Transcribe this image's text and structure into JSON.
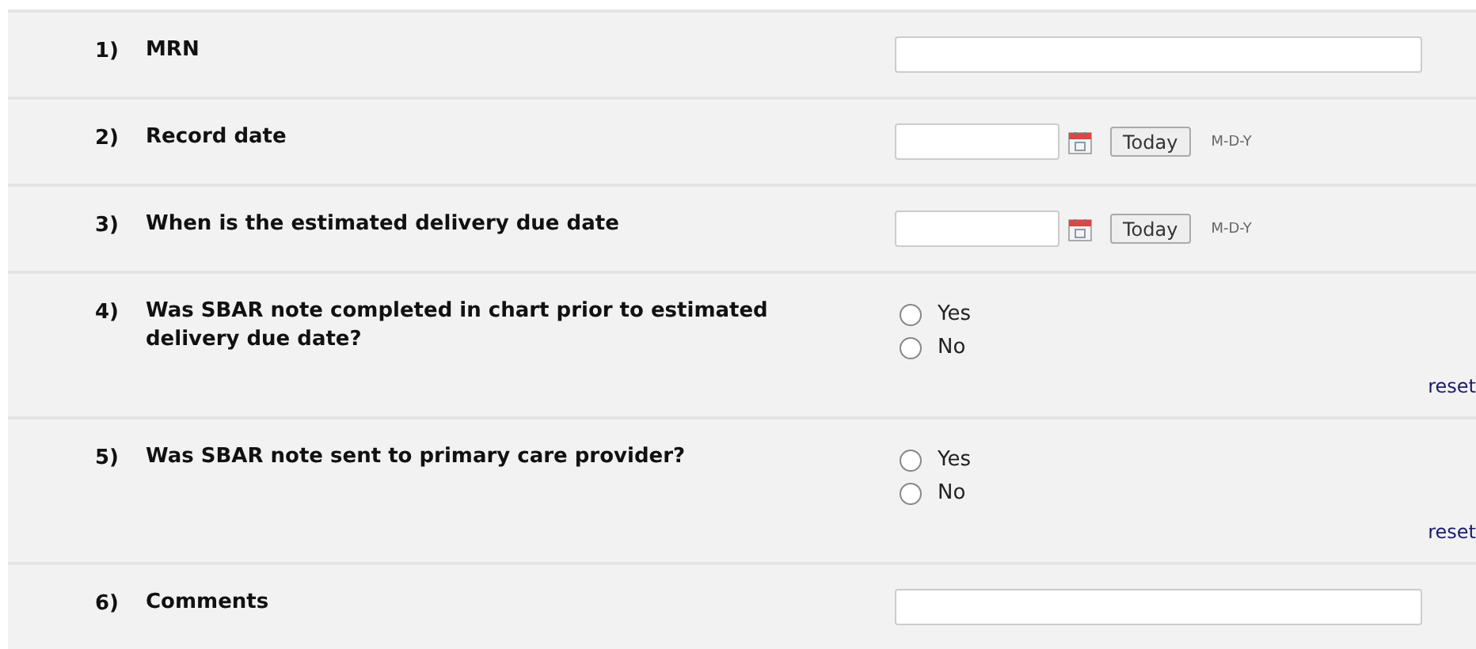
{
  "questions": [
    {
      "number": "1)",
      "label": "MRN",
      "kind": "text"
    },
    {
      "number": "2)",
      "label": "Record date",
      "kind": "date",
      "button": "Today",
      "format": "M-D-Y"
    },
    {
      "number": "3)",
      "label": "When is the estimated delivery due date",
      "kind": "date",
      "button": "Today",
      "format": "M-D-Y"
    },
    {
      "number": "4)",
      "label": "Was SBAR note completed in chart prior to estimated delivery due date?",
      "kind": "radio",
      "options": [
        {
          "label": "Yes",
          "selected": false
        },
        {
          "label": "No",
          "selected": false
        }
      ],
      "reset": "reset"
    },
    {
      "number": "5)",
      "label": "Was SBAR note sent to primary care provider?",
      "kind": "radio",
      "options": [
        {
          "label": "Yes",
          "selected": false
        },
        {
          "label": "No",
          "selected": false
        }
      ],
      "reset": "reset"
    },
    {
      "number": "6)",
      "label": "Comments",
      "kind": "text"
    }
  ]
}
